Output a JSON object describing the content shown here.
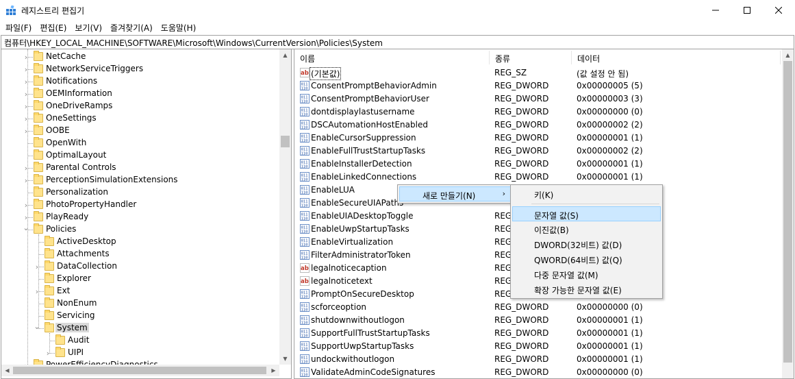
{
  "window": {
    "title": "레지스트리 편집기"
  },
  "menu": [
    "파일(F)",
    "편집(E)",
    "보기(V)",
    "즐겨찾기(A)",
    "도움말(H)"
  ],
  "address": "컴퓨터\\HKEY_LOCAL_MACHINE\\SOFTWARE\\Microsoft\\Windows\\CurrentVersion\\Policies\\System",
  "tree": [
    {
      "label": "NetCache",
      "expandable": true
    },
    {
      "label": "NetworkServiceTriggers",
      "expandable": true
    },
    {
      "label": "Notifications",
      "expandable": true
    },
    {
      "label": "OEMInformation",
      "expandable": true
    },
    {
      "label": "OneDriveRamps",
      "expandable": true
    },
    {
      "label": "OneSettings",
      "expandable": true
    },
    {
      "label": "OOBE",
      "expandable": true
    },
    {
      "label": "OpenWith",
      "expandable": false
    },
    {
      "label": "OptimalLayout",
      "expandable": false
    },
    {
      "label": "Parental Controls",
      "expandable": true
    },
    {
      "label": "PerceptionSimulationExtensions",
      "expandable": true
    },
    {
      "label": "Personalization",
      "expandable": false
    },
    {
      "label": "PhotoPropertyHandler",
      "expandable": true
    },
    {
      "label": "PlayReady",
      "expandable": true
    },
    {
      "label": "Policies",
      "expandable": true,
      "expanded": true
    },
    {
      "label": "ActiveDesktop",
      "expandable": false
    },
    {
      "label": "Attachments",
      "expandable": false
    },
    {
      "label": "DataCollection",
      "expandable": true
    },
    {
      "label": "Explorer",
      "expandable": false
    },
    {
      "label": "Ext",
      "expandable": true
    },
    {
      "label": "NonEnum",
      "expandable": false
    },
    {
      "label": "Servicing",
      "expandable": false
    },
    {
      "label": "System",
      "expandable": true,
      "expanded": true,
      "selected": true
    },
    {
      "label": "Audit",
      "expandable": false
    },
    {
      "label": "UIPI",
      "expandable": true
    },
    {
      "label": "PowerEfficiencyDiagnostics",
      "expandable": true
    }
  ],
  "list": {
    "columns": [
      "이름",
      "종류",
      "데이터"
    ],
    "rows": [
      {
        "name": "(기본값)",
        "type": "REG_SZ",
        "data": "(값 설정 안 됨)",
        "icon": "ab"
      },
      {
        "name": "ConsentPromptBehaviorAdmin",
        "type": "REG_DWORD",
        "data": "0x00000005 (5)",
        "icon": "bin"
      },
      {
        "name": "ConsentPromptBehaviorUser",
        "type": "REG_DWORD",
        "data": "0x00000003 (3)",
        "icon": "bin"
      },
      {
        "name": "dontdisplaylastusername",
        "type": "REG_DWORD",
        "data": "0x00000000 (0)",
        "icon": "bin"
      },
      {
        "name": "DSCAutomationHostEnabled",
        "type": "REG_DWORD",
        "data": "0x00000002 (2)",
        "icon": "bin"
      },
      {
        "name": "EnableCursorSuppression",
        "type": "REG_DWORD",
        "data": "0x00000001 (1)",
        "icon": "bin"
      },
      {
        "name": "EnableFullTrustStartupTasks",
        "type": "REG_DWORD",
        "data": "0x00000002 (2)",
        "icon": "bin"
      },
      {
        "name": "EnableInstallerDetection",
        "type": "REG_DWORD",
        "data": "0x00000001 (1)",
        "icon": "bin"
      },
      {
        "name": "EnableLinkedConnections",
        "type": "REG_DWORD",
        "data": "0x00000001 (1)",
        "icon": "bin"
      },
      {
        "name": "EnableLUA",
        "type": "",
        "data": "",
        "icon": "bin"
      },
      {
        "name": "EnableSecureUIAPaths",
        "type": "",
        "data": "",
        "icon": "bin"
      },
      {
        "name": "EnableUIADesktopToggle",
        "type": "REG_",
        "data": "",
        "icon": "bin"
      },
      {
        "name": "EnableUwpStartupTasks",
        "type": "REG_",
        "data": "",
        "icon": "bin"
      },
      {
        "name": "EnableVirtualization",
        "type": "REG_",
        "data": "",
        "icon": "bin"
      },
      {
        "name": "FilterAdministratorToken",
        "type": "REG_",
        "data": "",
        "icon": "bin"
      },
      {
        "name": "legalnoticecaption",
        "type": "REG_",
        "data": "",
        "icon": "ab"
      },
      {
        "name": "legalnoticetext",
        "type": "REG_",
        "data": "",
        "icon": "ab"
      },
      {
        "name": "PromptOnSecureDesktop",
        "type": "REG_",
        "data": "",
        "icon": "bin"
      },
      {
        "name": "scforceoption",
        "type": "REG_DWORD",
        "data": "0x00000000 (0)",
        "icon": "bin"
      },
      {
        "name": "shutdownwithoutlogon",
        "type": "REG_DWORD",
        "data": "0x00000001 (1)",
        "icon": "bin"
      },
      {
        "name": "SupportFullTrustStartupTasks",
        "type": "REG_DWORD",
        "data": "0x00000001 (1)",
        "icon": "bin"
      },
      {
        "name": "SupportUwpStartupTasks",
        "type": "REG_DWORD",
        "data": "0x00000001 (1)",
        "icon": "bin"
      },
      {
        "name": "undockwithoutlogon",
        "type": "REG_DWORD",
        "data": "0x00000001 (1)",
        "icon": "bin"
      },
      {
        "name": "ValidateAdminCodeSignatures",
        "type": "REG_DWORD",
        "data": "0x00000000 (0)",
        "icon": "bin"
      }
    ]
  },
  "context_menu": {
    "new_label": "새로 만들기(N)",
    "submenu": {
      "key": "키(K)",
      "items": [
        {
          "label": "문자열 값(S)",
          "highlighted": true
        },
        {
          "label": "이진값(B)"
        },
        {
          "label": "DWORD(32비트) 값(D)"
        },
        {
          "label": "QWORD(64비트) 값(Q)"
        },
        {
          "label": "다중 문자열 값(M)"
        },
        {
          "label": "확장 가능한 문자열 값(E)"
        }
      ]
    }
  },
  "colors": {
    "selection": "#cce8ff",
    "selection_border": "#99d1ff",
    "folder": "#ffe38c",
    "tree_selected": "#d9d9d9"
  }
}
